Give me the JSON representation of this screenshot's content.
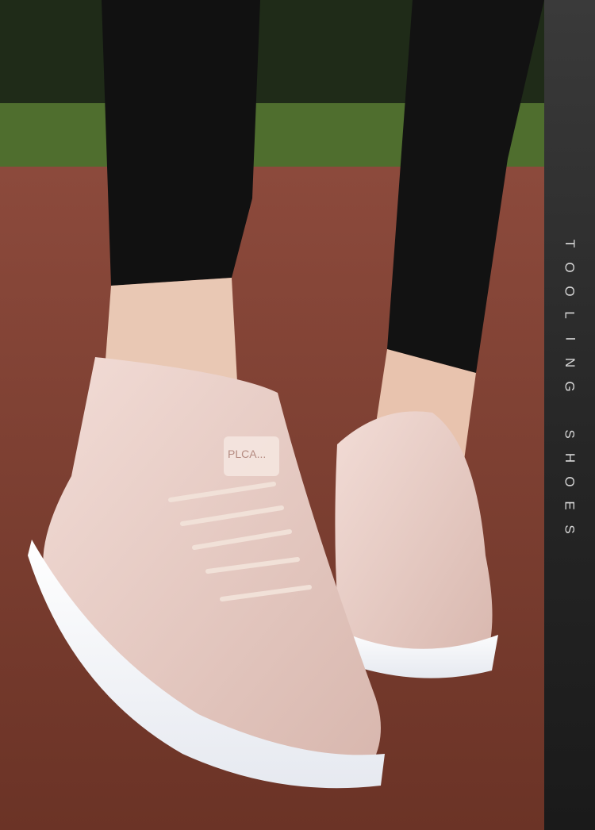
{
  "image": {
    "description_free": true,
    "side_label": {
      "letters": [
        "T",
        "O",
        "O",
        "L",
        "I",
        "N",
        "G",
        " ",
        "S",
        "H",
        "O",
        "E",
        "S"
      ]
    },
    "shoe_logo_text": "PLCA..."
  }
}
